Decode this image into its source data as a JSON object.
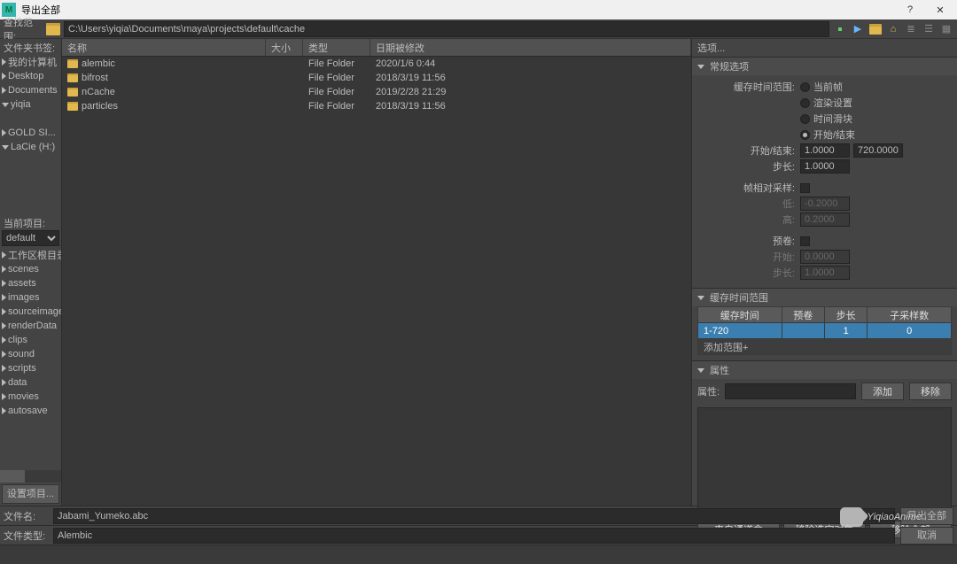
{
  "window": {
    "title": "导出全部",
    "help_glyph": "?",
    "close_glyph": "✕",
    "logo_letter": "M"
  },
  "path": {
    "label": "查找范围:",
    "value": "C:\\Users\\yiqia\\Documents\\maya\\projects\\default\\cache"
  },
  "bookmarks": {
    "label": "文件夹书签:",
    "items": [
      "我的计算机",
      "Desktop",
      "Documents",
      "yiqia",
      "",
      "GOLD SI...",
      "LaCie (H:)"
    ]
  },
  "project": {
    "label": "当前项目:",
    "combo": "default",
    "items": [
      "工作区根目录",
      "scenes",
      "assets",
      "images",
      "sourceimages",
      "renderData",
      "clips",
      "sound",
      "scripts",
      "data",
      "movies",
      "autosave"
    ],
    "set_button": "设置项目..."
  },
  "filelist": {
    "headers": {
      "name": "名称",
      "size": "大小",
      "type": "类型",
      "date": "日期被修改"
    },
    "rows": [
      {
        "name": "alembic",
        "type": "File Folder",
        "date": "2020/1/6 0:44"
      },
      {
        "name": "bifrost",
        "type": "File Folder",
        "date": "2018/3/19 11:56"
      },
      {
        "name": "nCache",
        "type": "File Folder",
        "date": "2019/2/28 21:29"
      },
      {
        "name": "particles",
        "type": "File Folder",
        "date": "2018/3/19 11:56"
      }
    ]
  },
  "options": {
    "header": "选项...",
    "general": {
      "title": "常规选项",
      "range_label": "缓存时间范围:",
      "range_opts": [
        "当前帧",
        "渲染设置",
        "时间滑块",
        "开始/结束"
      ],
      "range_selected": 3,
      "startend_label": "开始/结束:",
      "start_value": "1.0000",
      "end_value": "720.0000",
      "step_label": "步长:",
      "step_value": "1.0000",
      "frame_rel_label": "帧相对采样:",
      "low_label": "低:",
      "low_value": "-0.2000",
      "high_label": "高:",
      "high_value": "0.2000",
      "preroll_label": "预卷:",
      "preroll_start_label": "开始:",
      "preroll_start_value": "0.0000",
      "preroll_step_label": "步长:",
      "preroll_step_value": "1.0000"
    },
    "cache_range": {
      "title": "缓存时间范围",
      "cols": [
        "缓存时间",
        "预卷",
        "步长",
        "子采样数"
      ],
      "row": [
        "1-720",
        "",
        "1",
        "0"
      ],
      "add": "添加范围+"
    },
    "attributes": {
      "title": "属性",
      "label": "属性:",
      "add_btn": "添加",
      "remove_btn": "移除"
    },
    "bottom_buttons": [
      "来自通道盒",
      "移除选定对象",
      "移除全部"
    ]
  },
  "footer": {
    "filename_label": "文件名:",
    "filename_value": "Jabami_Yumeko.abc",
    "filetype_label": "文件类型:",
    "filetype_value": "Alembic",
    "export_btn": "导出全部",
    "cancel_btn": "取消"
  },
  "watermark": "YiqiaoAnime"
}
